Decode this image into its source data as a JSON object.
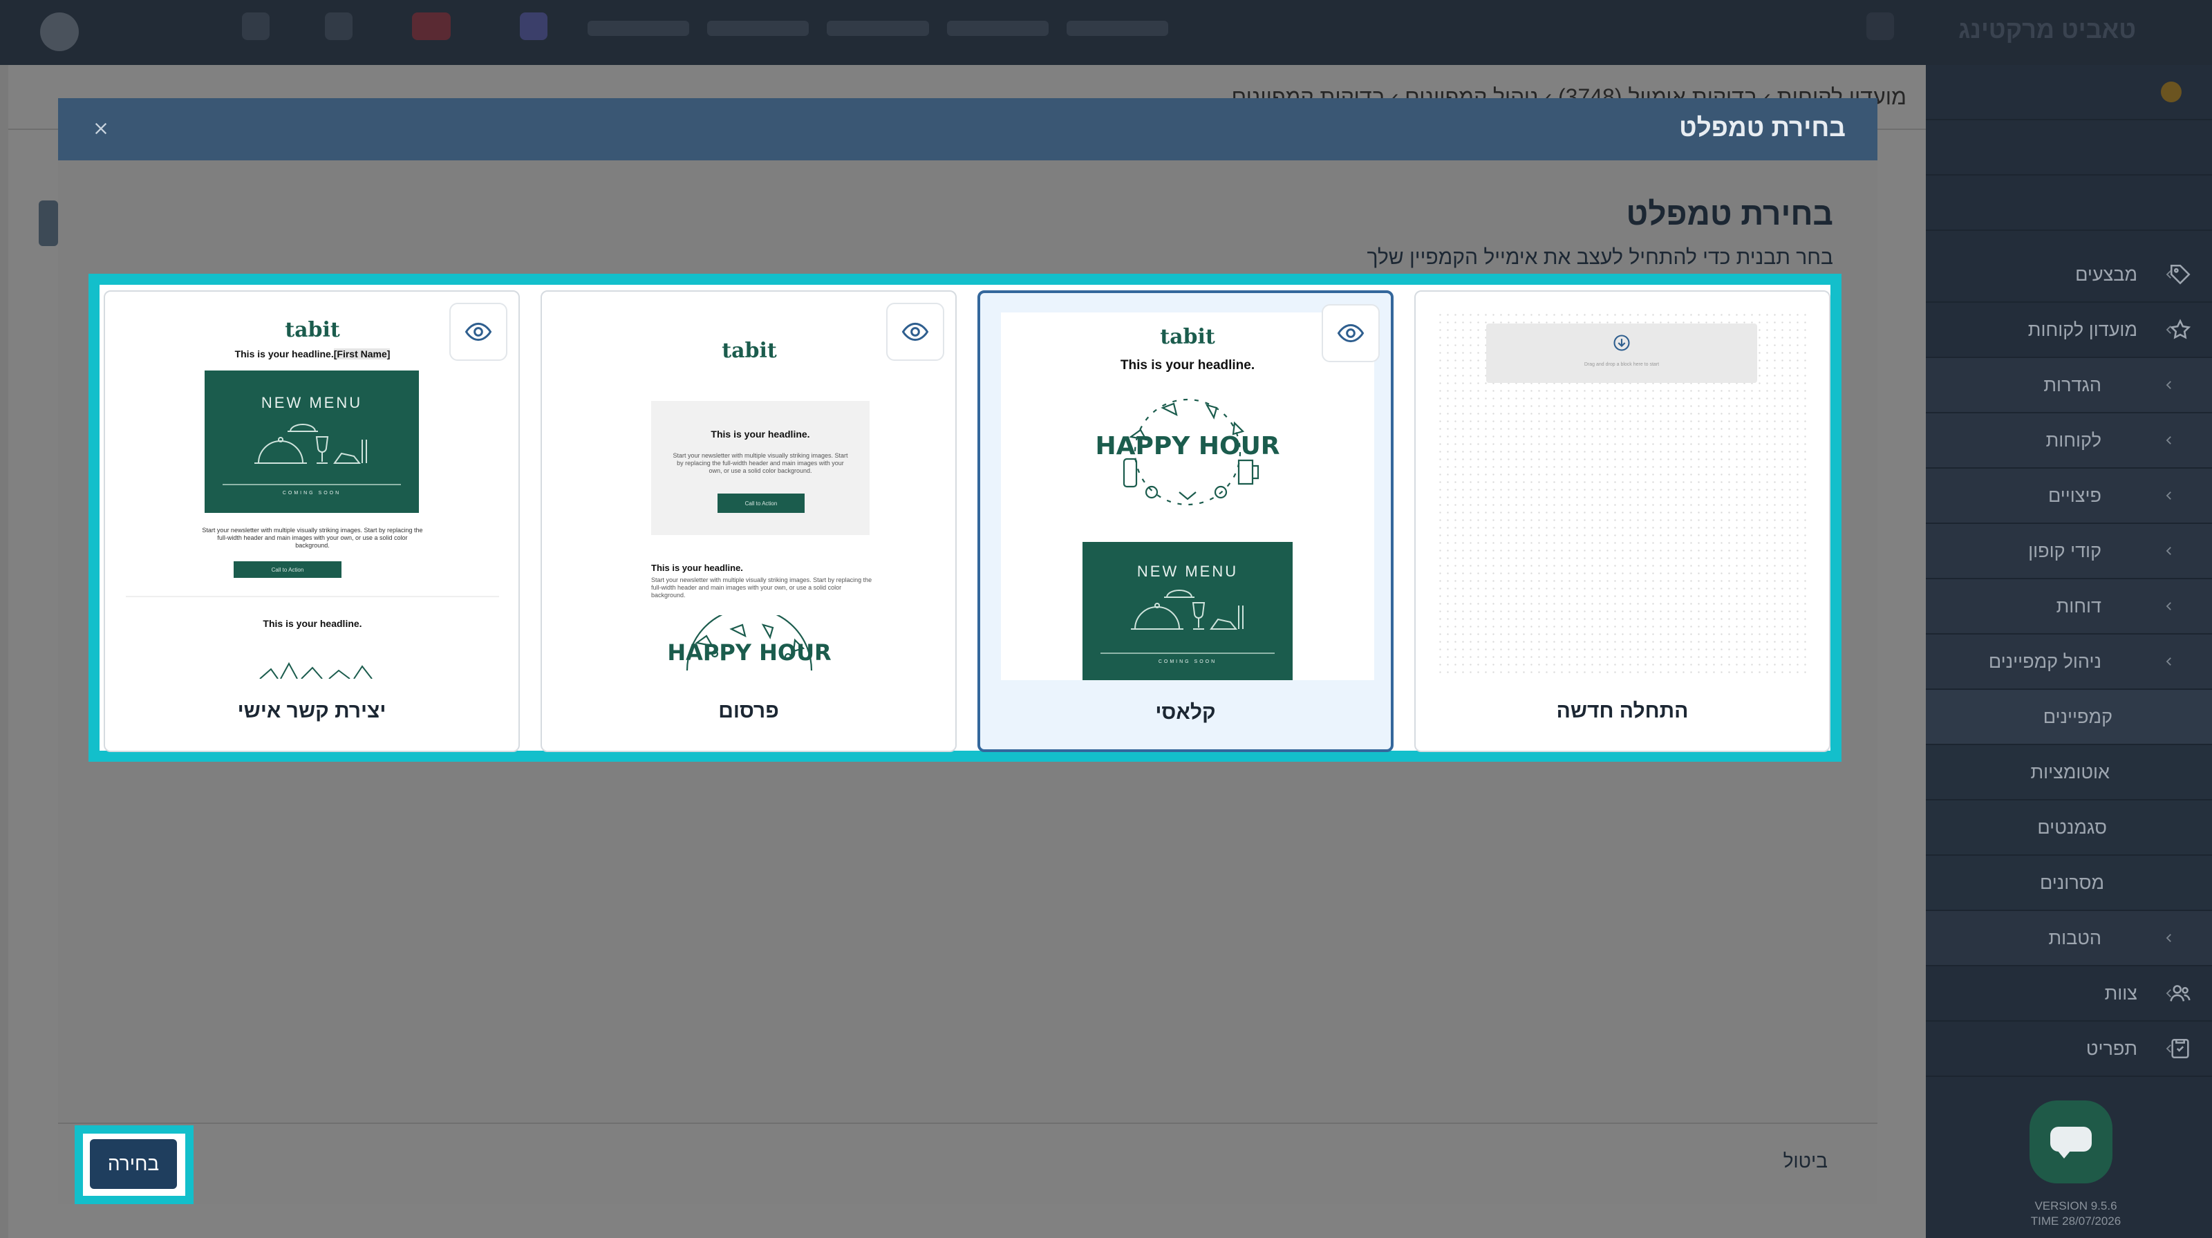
{
  "app": {
    "brand": "טאביט מרקטינג",
    "version": "VERSION 9.5.6",
    "time": "TIME 28/07/2026"
  },
  "sidebar": {
    "items": [
      {
        "label": "מבצעים",
        "icon": "tag-icon"
      },
      {
        "label": "מועדון לקוחות",
        "icon": "star-icon"
      },
      {
        "label": "הגדרות"
      },
      {
        "label": "לקוחות"
      },
      {
        "label": "פיצויים"
      },
      {
        "label": "קודי קופון"
      },
      {
        "label": "דוחות"
      },
      {
        "label": "ניהול קמפיינים"
      },
      {
        "label": "קמפיינים"
      },
      {
        "label": "אוטומציות"
      },
      {
        "label": "סגמנטים"
      },
      {
        "label": "מסרונים"
      },
      {
        "label": "הטבות"
      },
      {
        "label": "צוות",
        "icon": "team-icon"
      },
      {
        "label": "תפריט",
        "icon": "menu-book-icon"
      }
    ]
  },
  "page": {
    "breadcrumb": "מועדון לקוחות  ›  בדיקות אימייל (3748)  ›  ניהול קמפיינים  ›  בדיקות קמפיינים"
  },
  "modal": {
    "header_title": "בחירת טמפלט",
    "title": "בחירת טמפלט",
    "subtitle": "בחר תבנית כדי להתחיל לעצב את אימייל הקמפיין שלך",
    "select_label": "בחירה",
    "cancel_label": "ביטול",
    "highlight_color": "#13bfcb",
    "templates": [
      {
        "label": "התחלה חדשה",
        "drop_text": "Drag and drop a block here to start"
      },
      {
        "label": "קלאסי",
        "selected": true,
        "logo": "tabit",
        "headline": "This is your headline.",
        "happy_hour": "HAPPY HOUR",
        "new_menu": "NEW MENU",
        "coming_soon": "COMING SOON"
      },
      {
        "label": "פרסום",
        "logo": "tabit",
        "headline": "This is your headline.",
        "body": "Start your newsletter with multiple visually striking images. Start by replacing the full-width header and main images with your own, or use a solid color background.",
        "cta": "Call to Action",
        "headline2": "This is your headline.",
        "body2": "Start your newsletter with multiple visually striking images. Start by replacing the full-width header and main images with your own, or use a solid color background.",
        "happy_hour": "HAPPY HOUR"
      },
      {
        "label": "יצירת קשר אישי",
        "logo": "tabit",
        "headline": "This is your headline.",
        "merge_tag": "[First Name]",
        "new_menu": "NEW MENU",
        "coming_soon": "COMING SOON",
        "body": "Start your newsletter with multiple visually striking images. Start by replacing the full-width header and main images with your own, or use a solid color background.",
        "cta": "Call to Action",
        "headline2": "This is your headline."
      }
    ]
  }
}
